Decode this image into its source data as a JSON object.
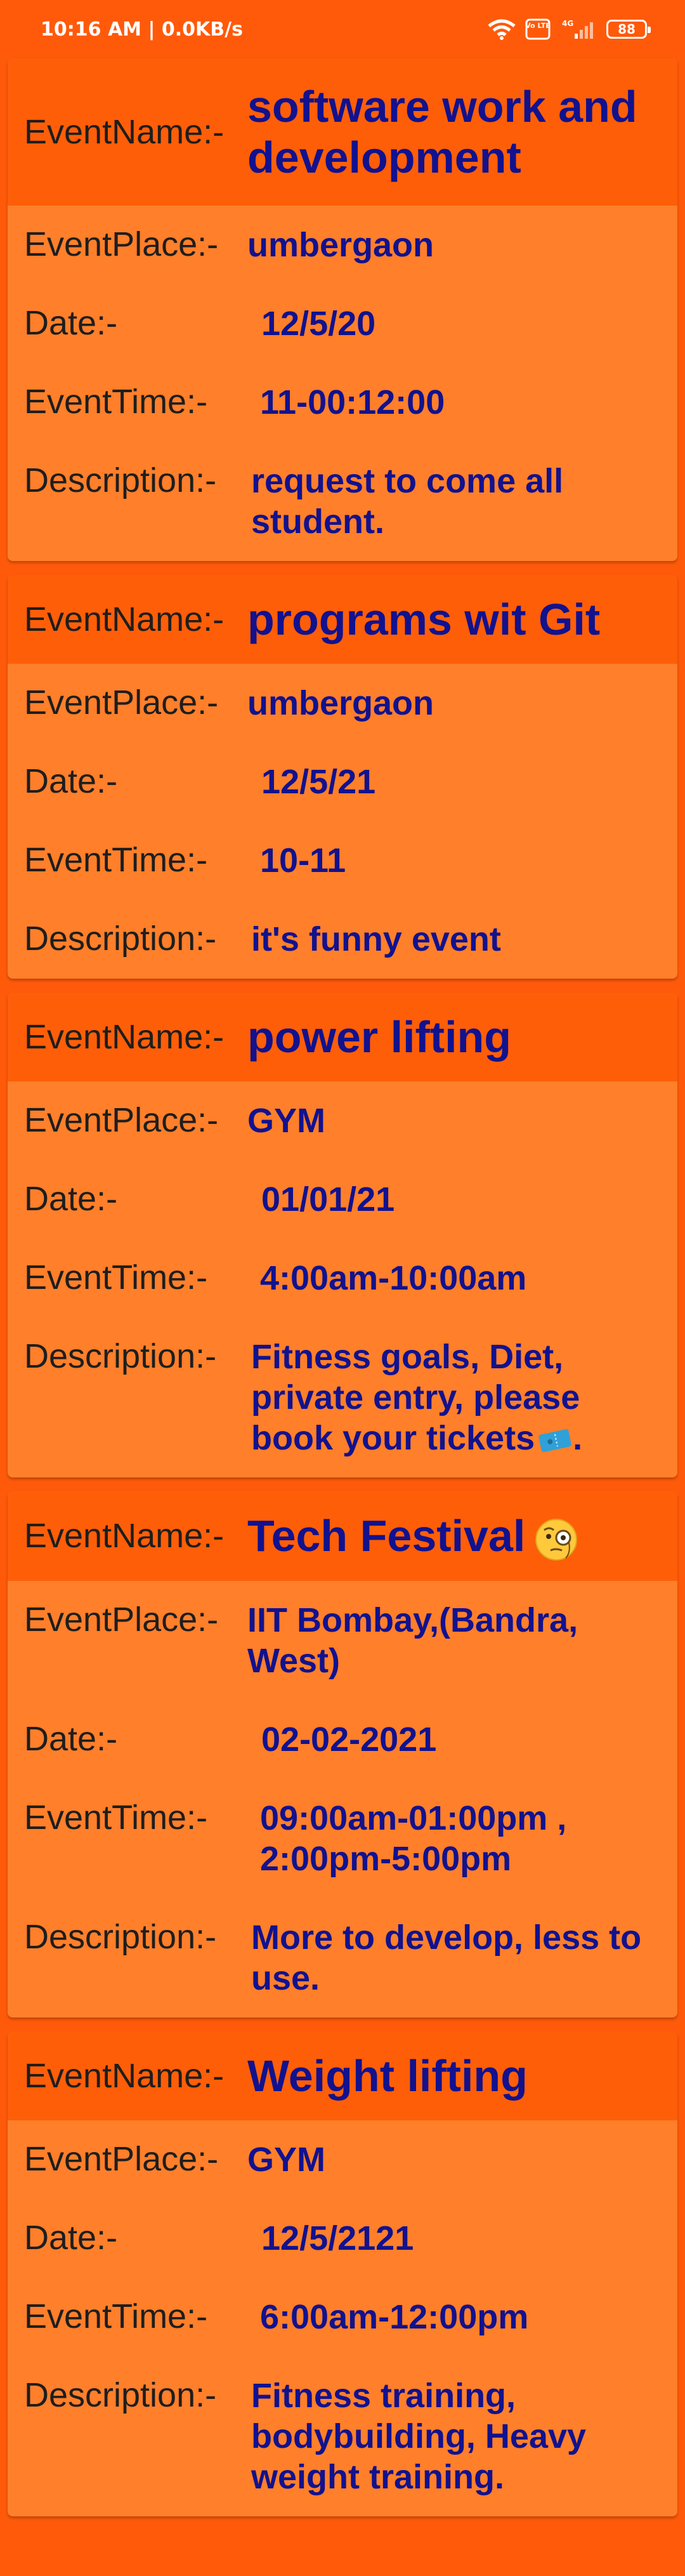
{
  "status": {
    "time": "10:16 AM | 0.0KB/s",
    "network": "4G",
    "volte": "Vo LTE",
    "battery": "88"
  },
  "labels": {
    "name": "EventName:-",
    "place": "EventPlace:-",
    "date": "Date:-",
    "time": "EventTime:-",
    "description": "Description:-"
  },
  "events": [
    {
      "name": "software work and development",
      "place": "umbergaon",
      "date": "12/5/20",
      "time": "11-00:12:00",
      "description": "request to come all student."
    },
    {
      "name": "programs wit Git",
      "place": "umbergaon",
      "date": "12/5/21",
      "time": "10-11",
      "description": "it's funny event"
    },
    {
      "name": "power lifting",
      "place": "GYM",
      "date": "01/01/21",
      "time": "4:00am-10:00am",
      "description": "Fitness goals, Diet, private entry, please book your tickets",
      "description_suffix": "."
    },
    {
      "name": "Tech Festival",
      "place": "IIT Bombay,(Bandra, West)",
      "date": "02-02-2021",
      "time": "09:00am-01:00pm , 2:00pm-5:00pm",
      "description": "More to develop, less to use."
    },
    {
      "name": "Weight lifting",
      "place": "GYM",
      "date": "12/5/2121",
      "time": "6:00am-12:00pm",
      "description": "Fitness training, bodybuilding, Heavy weight training."
    }
  ],
  "icons": {
    "tech_festival_emoji": "monocle-face-icon",
    "ticket_emoji": "ticket-icon"
  }
}
